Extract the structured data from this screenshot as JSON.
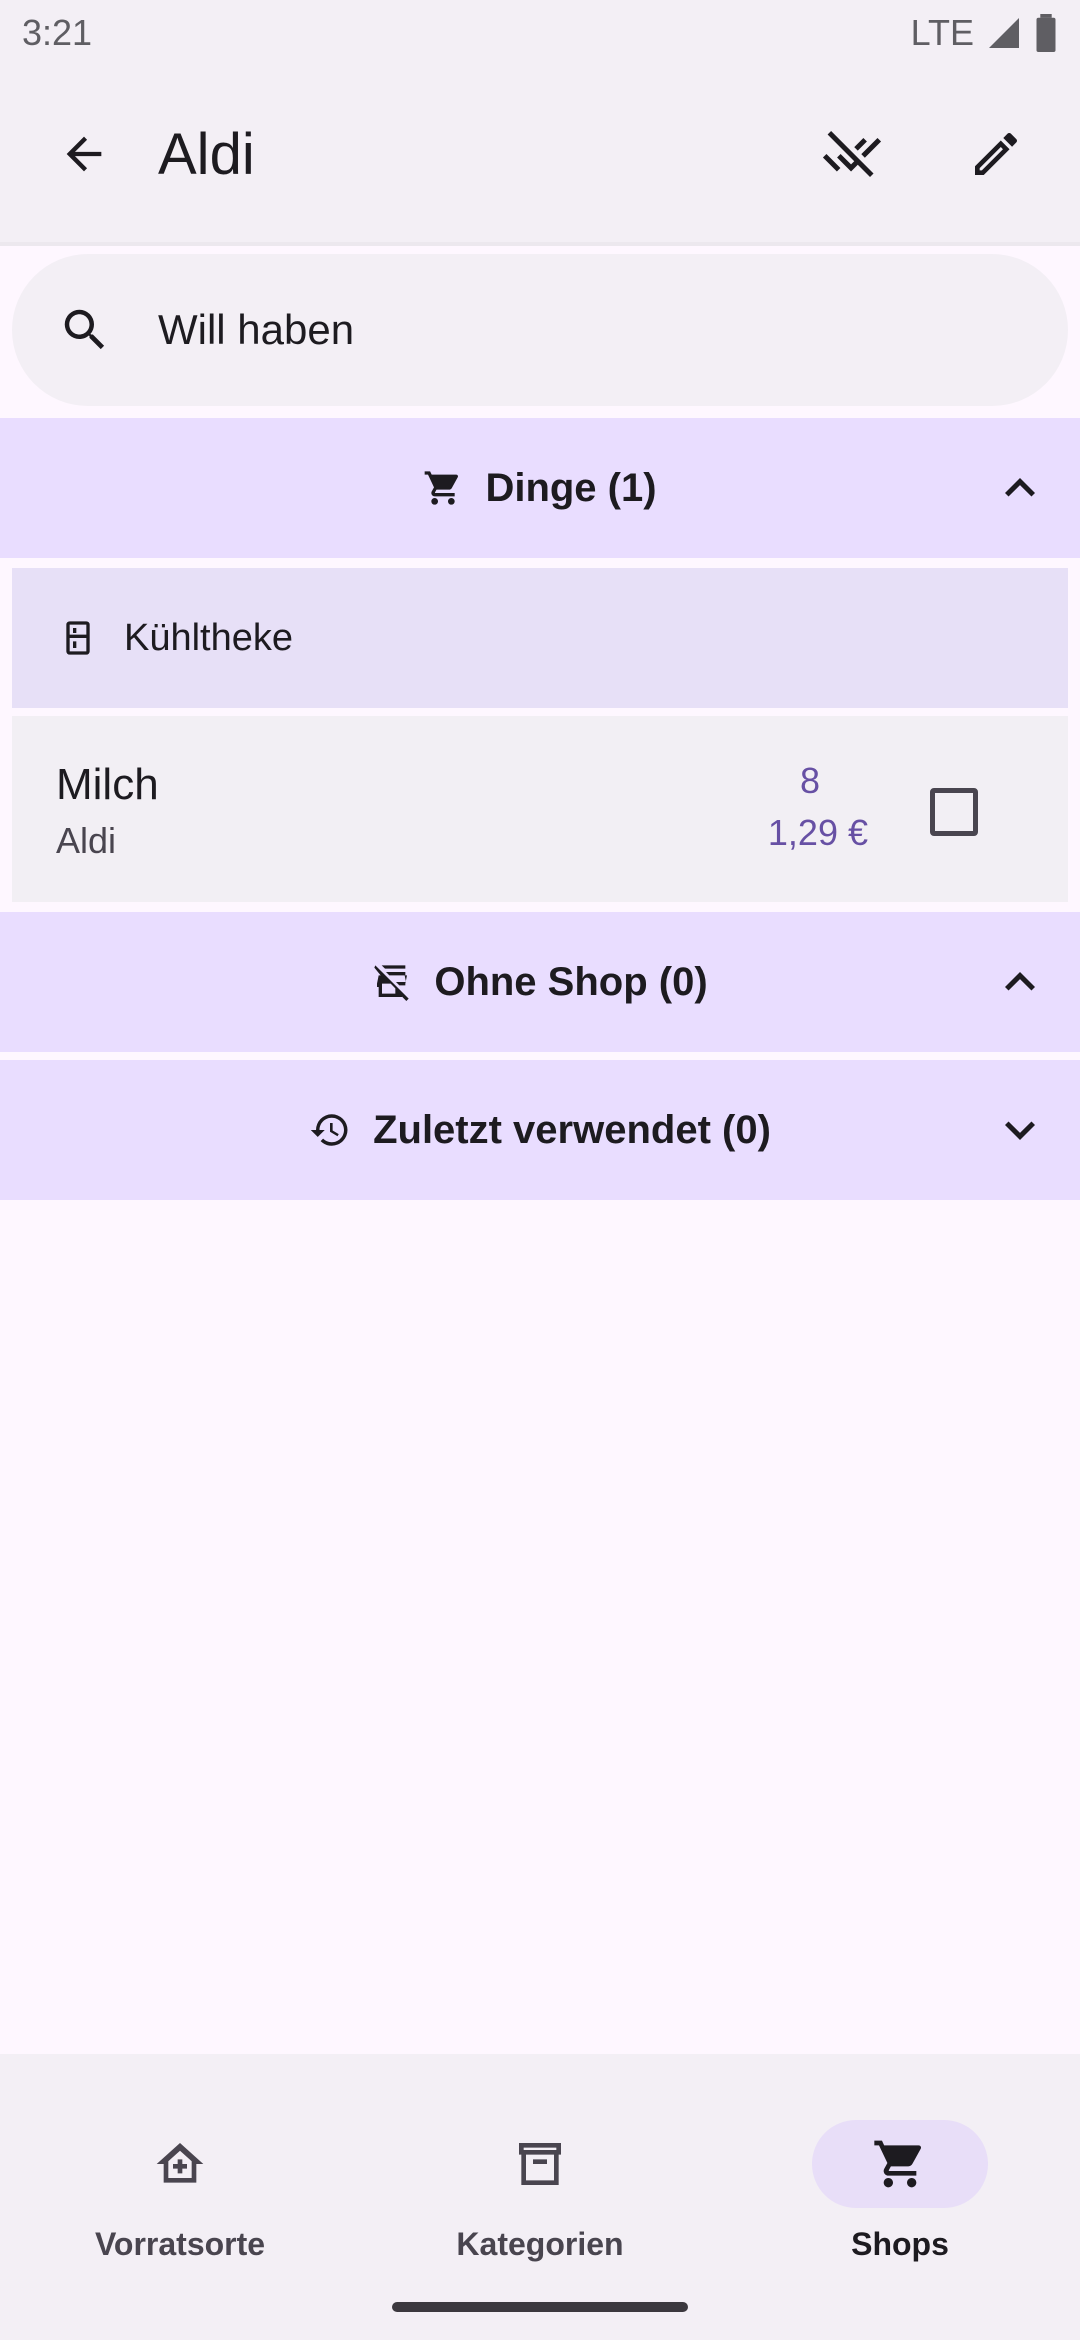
{
  "status_bar": {
    "time": "3:21",
    "network": "LTE"
  },
  "app_bar": {
    "title": "Aldi"
  },
  "search": {
    "placeholder": "Will haben"
  },
  "sections": {
    "dinge": {
      "title": "Dinge (1)",
      "expanded": true
    },
    "ohne_shop": {
      "title": "Ohne Shop (0)",
      "expanded": true
    },
    "zuletzt": {
      "title": "Zuletzt verwendet (0)",
      "expanded": false
    }
  },
  "location": {
    "label": "Kühltheke"
  },
  "item": {
    "name": "Milch",
    "shop": "Aldi",
    "quantity": "8",
    "price": "1,29 €",
    "checked": false
  },
  "nav": {
    "items": [
      {
        "label": "Vorratsorte",
        "icon": "storage-home-icon",
        "active": false
      },
      {
        "label": "Kategorien",
        "icon": "archive-box-icon",
        "active": false
      },
      {
        "label": "Shops",
        "icon": "shopping-cart-icon",
        "active": true
      }
    ]
  },
  "colors": {
    "accent": "#6750a4",
    "section_bg": "#e9ddff",
    "surface": "#f3eff5"
  }
}
